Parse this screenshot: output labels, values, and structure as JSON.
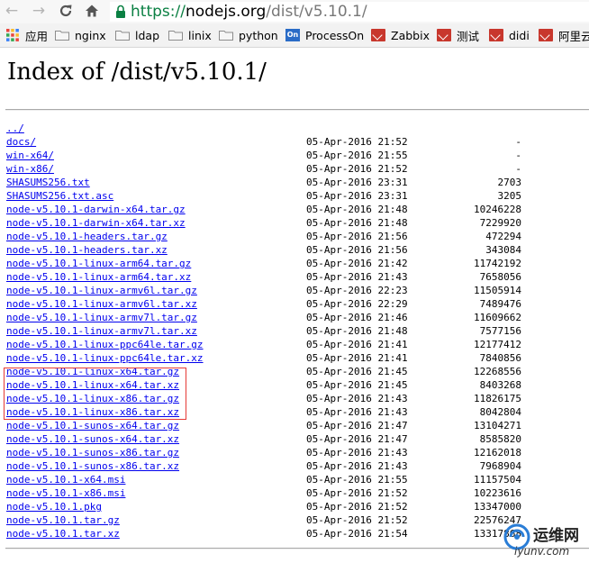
{
  "browser": {
    "url_scheme": "https://",
    "url_host": "nodejs.org",
    "url_path": "/dist/v5.10.1/",
    "bookmarks": [
      {
        "label": "应用",
        "icon": "apps-grid-icon"
      },
      {
        "label": "nginx",
        "icon": "folder-icon"
      },
      {
        "label": "ldap",
        "icon": "folder-icon"
      },
      {
        "label": "linix",
        "icon": "folder-icon"
      },
      {
        "label": "python",
        "icon": "folder-icon"
      },
      {
        "label": "ProcessOn",
        "icon": "processon-icon"
      },
      {
        "label": "Zabbix",
        "icon": "bookmark-page-icon"
      },
      {
        "label": "测试",
        "icon": "bookmark-page-icon"
      },
      {
        "label": "didi",
        "icon": "bookmark-page-icon"
      },
      {
        "label": "阿里云",
        "icon": "bookmark-page-icon"
      }
    ]
  },
  "page": {
    "title": "Index of /dist/v5.10.1/",
    "parent_link": "../",
    "entries": [
      {
        "name": "docs/",
        "date": "05-Apr-2016 21:52",
        "size": "-"
      },
      {
        "name": "win-x64/",
        "date": "05-Apr-2016 21:55",
        "size": "-"
      },
      {
        "name": "win-x86/",
        "date": "05-Apr-2016 21:52",
        "size": "-"
      },
      {
        "name": "SHASUMS256.txt",
        "date": "05-Apr-2016 23:31",
        "size": "2703"
      },
      {
        "name": "SHASUMS256.txt.asc",
        "date": "05-Apr-2016 23:31",
        "size": "3205"
      },
      {
        "name": "node-v5.10.1-darwin-x64.tar.gz",
        "date": "05-Apr-2016 21:48",
        "size": "10246228"
      },
      {
        "name": "node-v5.10.1-darwin-x64.tar.xz",
        "date": "05-Apr-2016 21:48",
        "size": "7229920"
      },
      {
        "name": "node-v5.10.1-headers.tar.gz",
        "date": "05-Apr-2016 21:56",
        "size": "472294"
      },
      {
        "name": "node-v5.10.1-headers.tar.xz",
        "date": "05-Apr-2016 21:56",
        "size": "343084"
      },
      {
        "name": "node-v5.10.1-linux-arm64.tar.gz",
        "date": "05-Apr-2016 21:42",
        "size": "11742192"
      },
      {
        "name": "node-v5.10.1-linux-arm64.tar.xz",
        "date": "05-Apr-2016 21:43",
        "size": "7658056"
      },
      {
        "name": "node-v5.10.1-linux-armv6l.tar.gz",
        "date": "05-Apr-2016 22:23",
        "size": "11505914"
      },
      {
        "name": "node-v5.10.1-linux-armv6l.tar.xz",
        "date": "05-Apr-2016 22:29",
        "size": "7489476"
      },
      {
        "name": "node-v5.10.1-linux-armv7l.tar.gz",
        "date": "05-Apr-2016 21:46",
        "size": "11609662"
      },
      {
        "name": "node-v5.10.1-linux-armv7l.tar.xz",
        "date": "05-Apr-2016 21:48",
        "size": "7577156"
      },
      {
        "name": "node-v5.10.1-linux-ppc64le.tar.gz",
        "date": "05-Apr-2016 21:41",
        "size": "12177412"
      },
      {
        "name": "node-v5.10.1-linux-ppc64le.tar.xz",
        "date": "05-Apr-2016 21:41",
        "size": "7840856"
      },
      {
        "name": "node-v5.10.1-linux-x64.tar.gz",
        "date": "05-Apr-2016 21:45",
        "size": "12268556"
      },
      {
        "name": "node-v5.10.1-linux-x64.tar.xz",
        "date": "05-Apr-2016 21:45",
        "size": "8403268"
      },
      {
        "name": "node-v5.10.1-linux-x86.tar.gz",
        "date": "05-Apr-2016 21:43",
        "size": "11826175"
      },
      {
        "name": "node-v5.10.1-linux-x86.tar.xz",
        "date": "05-Apr-2016 21:43",
        "size": "8042804"
      },
      {
        "name": "node-v5.10.1-sunos-x64.tar.gz",
        "date": "05-Apr-2016 21:47",
        "size": "13104271"
      },
      {
        "name": "node-v5.10.1-sunos-x64.tar.xz",
        "date": "05-Apr-2016 21:47",
        "size": "8585820"
      },
      {
        "name": "node-v5.10.1-sunos-x86.tar.gz",
        "date": "05-Apr-2016 21:43",
        "size": "12162018"
      },
      {
        "name": "node-v5.10.1-sunos-x86.tar.xz",
        "date": "05-Apr-2016 21:43",
        "size": "7968904"
      },
      {
        "name": "node-v5.10.1-x64.msi",
        "date": "05-Apr-2016 21:55",
        "size": "11157504"
      },
      {
        "name": "node-v5.10.1-x86.msi",
        "date": "05-Apr-2016 21:52",
        "size": "10223616"
      },
      {
        "name": "node-v5.10.1.pkg",
        "date": "05-Apr-2016 21:52",
        "size": "13347000"
      },
      {
        "name": "node-v5.10.1.tar.gz",
        "date": "05-Apr-2016 21:52",
        "size": "22576247"
      },
      {
        "name": "node-v5.10.1.tar.xz",
        "date": "05-Apr-2016 21:54",
        "size": "13317868"
      }
    ],
    "highlight_color": "#e53935",
    "link_color": "#0000ee"
  },
  "watermark": {
    "cn_text": "运维网",
    "en_text": "iyunv.com"
  }
}
